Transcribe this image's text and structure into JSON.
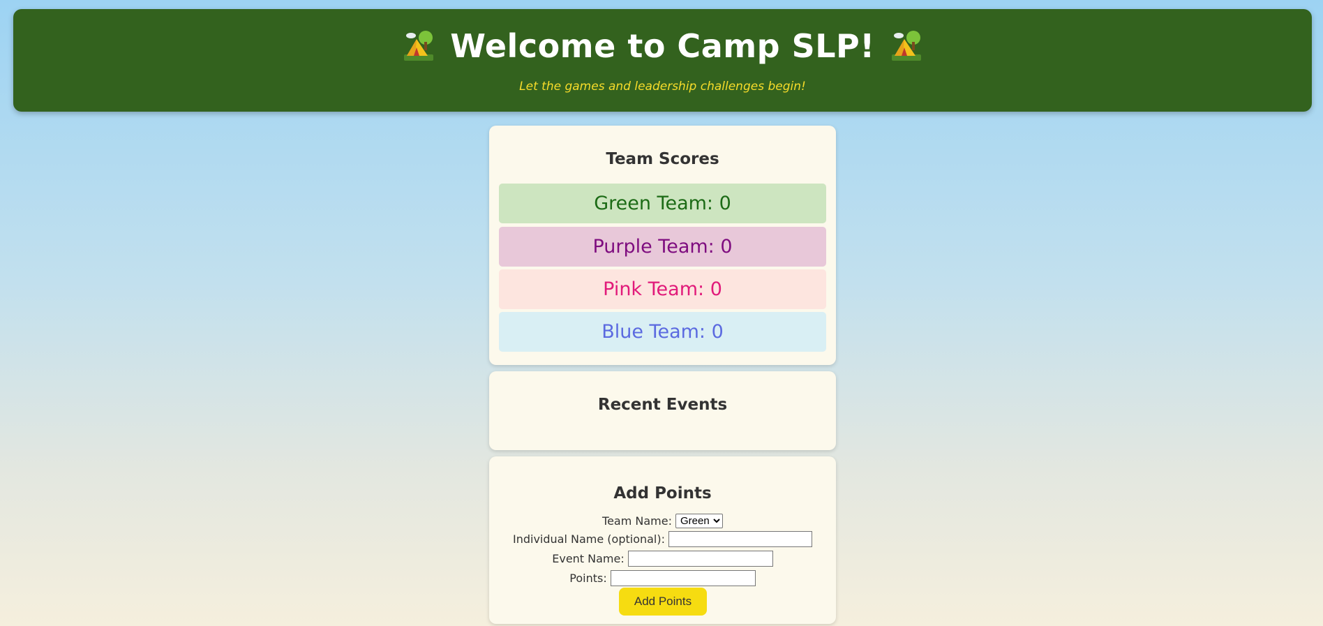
{
  "header": {
    "title": "Welcome to Camp SLP!",
    "subtitle": "Let the games and leadership challenges begin!",
    "icon": "tent-icon",
    "background_color": "#33621e",
    "subtitle_color": "#f7dc2a"
  },
  "scores": {
    "title": "Team Scores",
    "teams": [
      {
        "label": "Green Team: 0",
        "color": "#1c6b16",
        "bg": "#cde5c0"
      },
      {
        "label": "Purple Team: 0",
        "color": "#7e0c7f",
        "bg": "#e8c8d9"
      },
      {
        "label": "Pink Team: 0",
        "color": "#e11a7a",
        "bg": "#fde5df"
      },
      {
        "label": "Blue Team: 0",
        "color": "#5b6ae0",
        "bg": "#d9eff4"
      }
    ]
  },
  "events": {
    "title": "Recent Events"
  },
  "add_points": {
    "title": "Add Points",
    "team_label": "Team Name:",
    "team_selected": "Green",
    "individual_label": "Individual Name (optional):",
    "individual_value": "",
    "event_label": "Event Name:",
    "event_value": "",
    "points_label": "Points:",
    "points_value": "",
    "button_label": "Add Points",
    "button_color": "#f6dc11"
  }
}
